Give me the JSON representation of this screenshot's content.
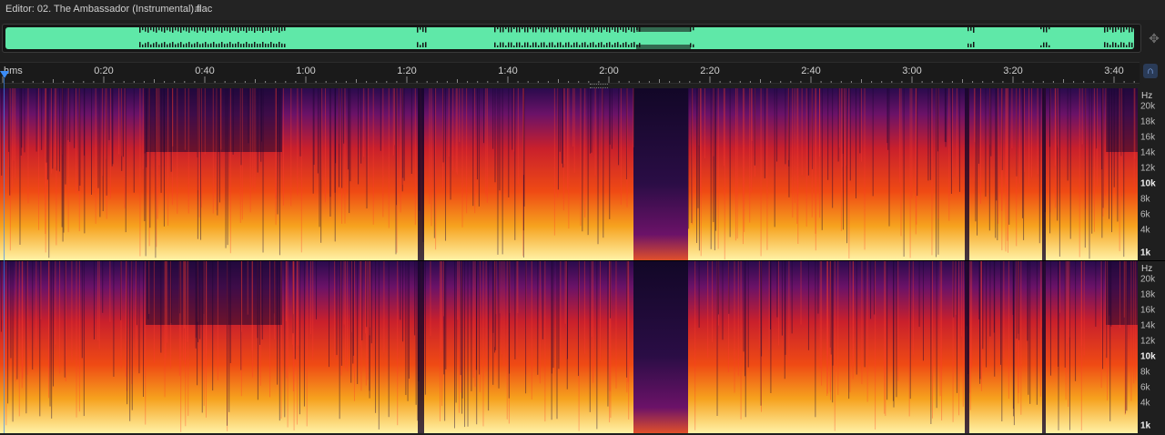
{
  "editor": {
    "title": "Editor: 02. The Ambassador (Instrumental).flac",
    "menu_icon": "hamburger-menu-icon"
  },
  "colors": {
    "waveform": "#5fe8a8",
    "playhead": "#3b8cf5",
    "spectrum_low": "#120727",
    "spectrum_mid": "#d81f2a",
    "spectrum_high": "#fff0a0"
  },
  "ruler": {
    "unit": "hms",
    "labels": [
      "0:20",
      "0:40",
      "1:00",
      "1:20",
      "1:40",
      "2:00",
      "2:20",
      "2:40",
      "3:00",
      "3:20",
      "3:40"
    ]
  },
  "channels": [
    {
      "hz_label": "Hz",
      "ticks": [
        "20k",
        "18k",
        "16k",
        "14k",
        "12k",
        "10k",
        "8k",
        "6k",
        "4k",
        "1k"
      ]
    },
    {
      "hz_label": "Hz",
      "ticks": [
        "20k",
        "18k",
        "16k",
        "14k",
        "12k",
        "10k",
        "8k",
        "6k",
        "4k",
        "1k"
      ]
    }
  ]
}
